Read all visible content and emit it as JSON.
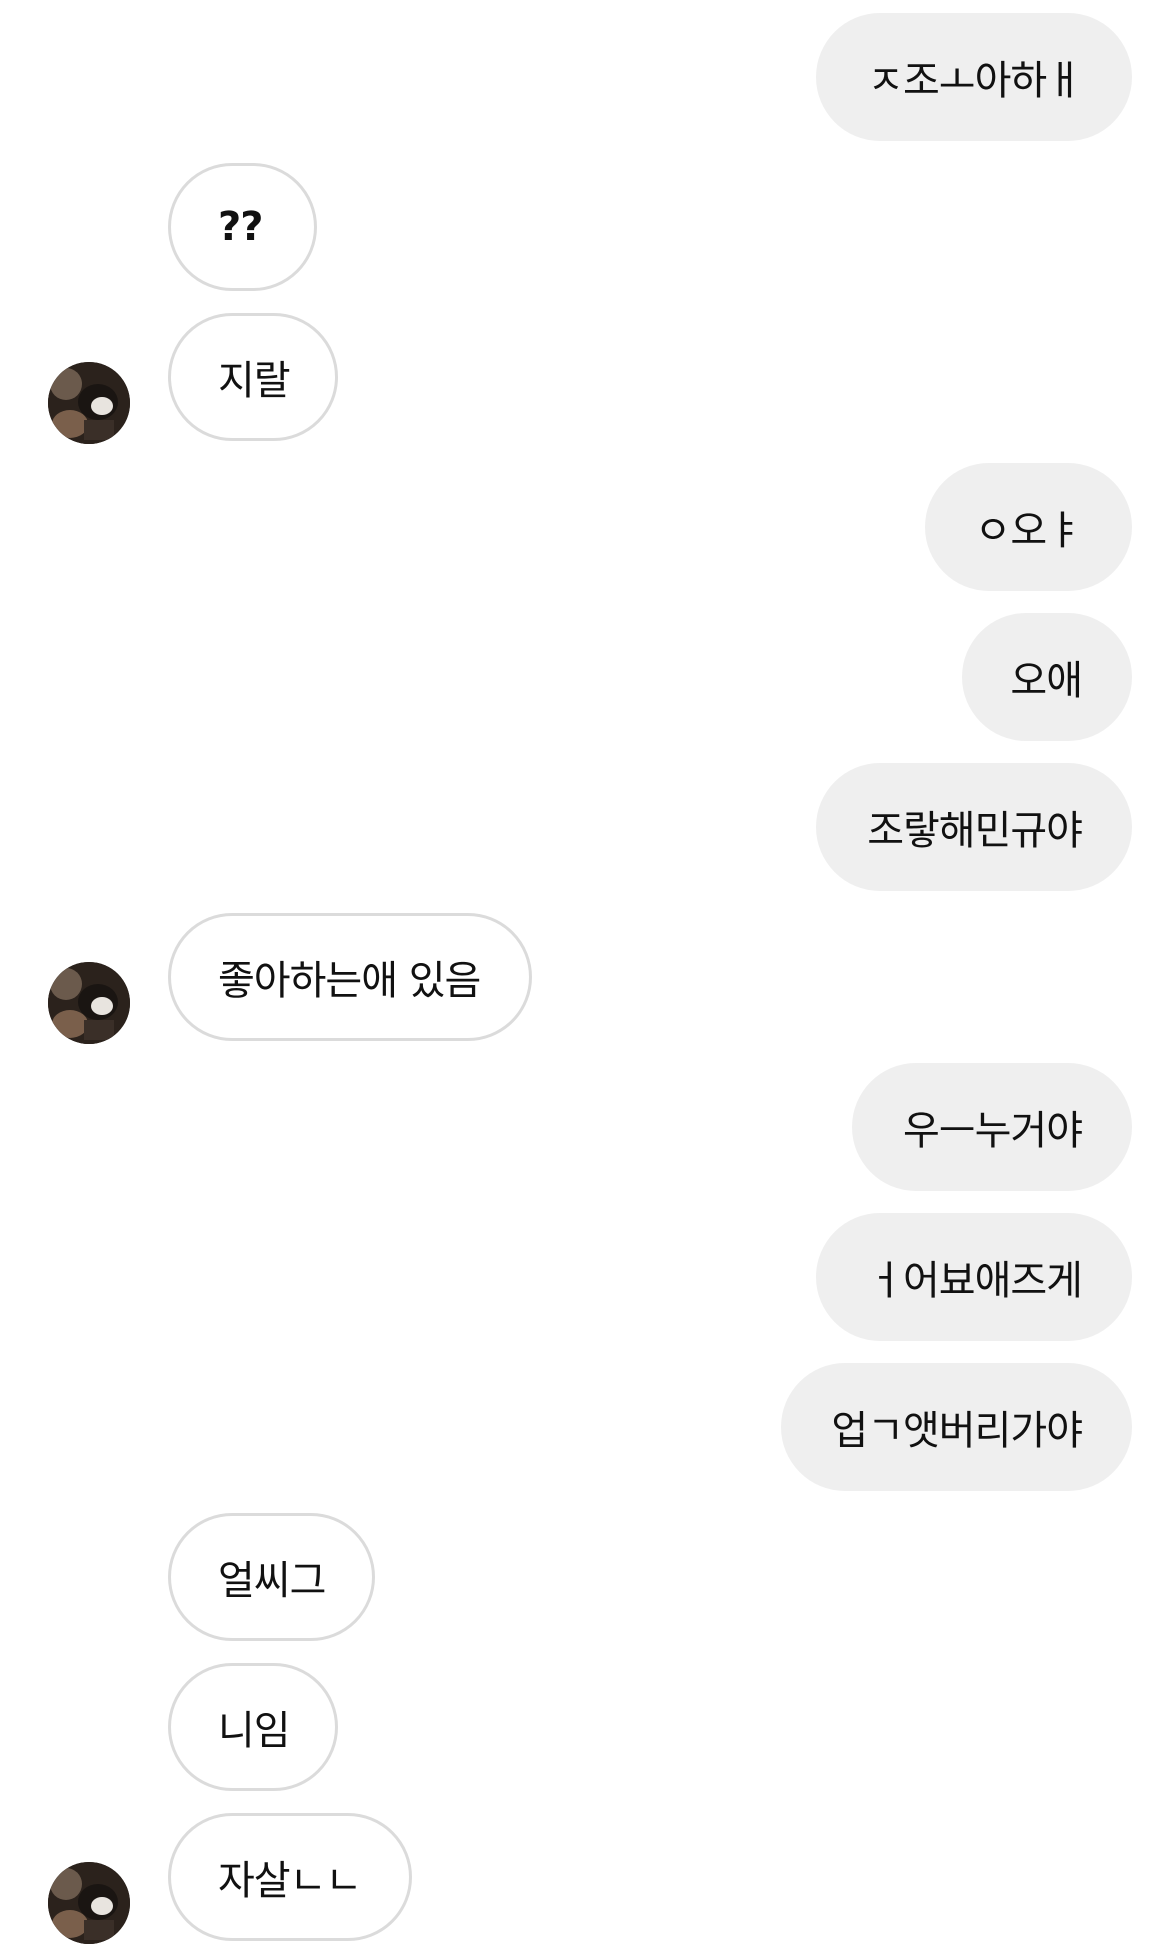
{
  "thread": {
    "messages": [
      {
        "sender": "me",
        "text": "ㅈ조ㅗ아하ㅐ"
      },
      {
        "sender": "other",
        "text": "??"
      },
      {
        "sender": "other",
        "text": "지랄"
      },
      {
        "sender": "me",
        "text": "ㅇ오ㅑ"
      },
      {
        "sender": "me",
        "text": "오애"
      },
      {
        "sender": "me",
        "text": "조랗해민규야"
      },
      {
        "sender": "other",
        "text": "좋아하는애 있음"
      },
      {
        "sender": "me",
        "text": "우ㅡ누거야"
      },
      {
        "sender": "me",
        "text": "ㅓ어뵤애즈게"
      },
      {
        "sender": "me",
        "text": "업ㄱ앳버리가야"
      },
      {
        "sender": "other",
        "text": "얼씨그"
      },
      {
        "sender": "other",
        "text": "니임"
      },
      {
        "sender": "other",
        "text": "자살ㄴㄴ"
      }
    ]
  },
  "colors": {
    "sent_bubble": "#efefef",
    "received_bubble_border": "#dbdbdb",
    "text": "#111111"
  },
  "icons": {
    "avatar": "profile-photo-avatar"
  }
}
